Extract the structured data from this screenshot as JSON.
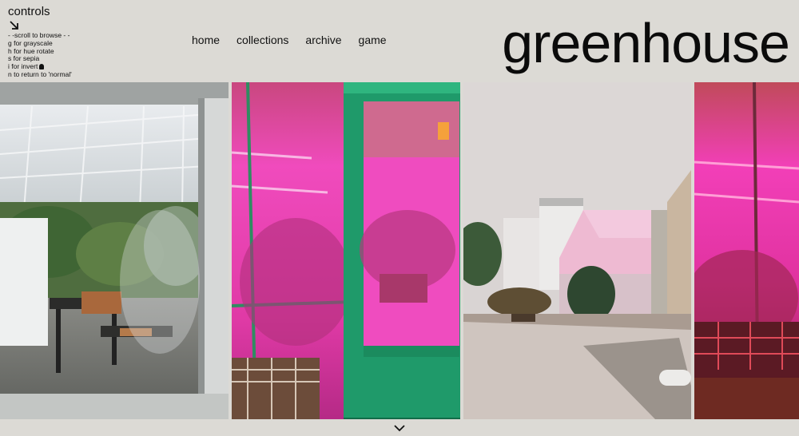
{
  "controls": {
    "title": "controls",
    "lines": [
      "- -scroll to browse - -",
      "g for grayscale",
      "h for hue rotate",
      "s for sepia",
      "i for invert",
      "n to return to 'normal'"
    ]
  },
  "nav": {
    "items": [
      "home",
      "collections",
      "archive",
      "game"
    ]
  },
  "brand": {
    "logo": "greenhouse"
  },
  "gallery": {
    "photos": [
      {
        "name": "greenhouse-window-photo"
      },
      {
        "name": "pink-greenhouse-door-photo"
      },
      {
        "name": "greenhouse-exterior-photo"
      },
      {
        "name": "pink-greenhouse-interior-photo"
      }
    ]
  },
  "colors": {
    "background": "#dcdad5",
    "text": "#111111",
    "pink_light": "#e43aa8",
    "door_green": "#1f9a6a"
  },
  "icons": [
    "arrow-down-right-icon",
    "ghost-icon",
    "chevron-down-icon"
  ]
}
